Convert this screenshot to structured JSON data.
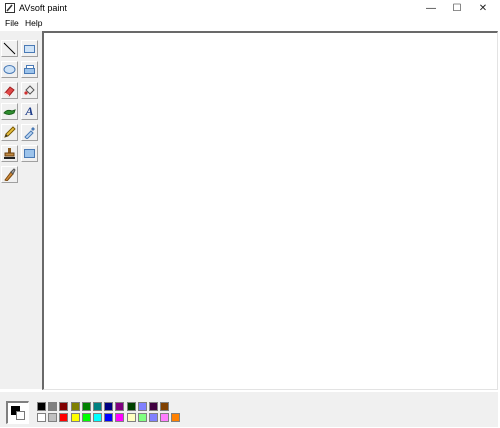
{
  "window": {
    "title": "AVsoft paint",
    "minimize_glyph": "—",
    "maximize_glyph": "☐",
    "close_glyph": "✕"
  },
  "menu": [
    {
      "label": "File"
    },
    {
      "label": "Help"
    }
  ],
  "tools": [
    {
      "name": "line-tool",
      "icon": "line-icon"
    },
    {
      "name": "rectangle-tool",
      "icon": "rectangle-icon"
    },
    {
      "name": "ellipse-tool",
      "icon": "ellipse-icon"
    },
    {
      "name": "filled-rectangle-tool",
      "icon": "filled-rectangle-icon"
    },
    {
      "name": "eraser-tool",
      "icon": "eraser-icon"
    },
    {
      "name": "fill-bucket-tool",
      "icon": "fill-bucket-icon"
    },
    {
      "name": "brush-tool",
      "icon": "brush-icon"
    },
    {
      "name": "text-tool",
      "icon": "text-icon",
      "glyph": "A"
    },
    {
      "name": "pencil-tool",
      "icon": "pencil-icon"
    },
    {
      "name": "color-picker-tool",
      "icon": "eyedropper-icon"
    },
    {
      "name": "stamp-tool",
      "icon": "stamp-icon"
    },
    {
      "name": "select-tool",
      "icon": "select-icon"
    },
    {
      "name": "spray-brush-tool",
      "icon": "spray-brush-icon"
    }
  ],
  "palette": {
    "foreground": "#000000",
    "background": "#ffffff",
    "row1": [
      "#000000",
      "#808080",
      "#800000",
      "#808000",
      "#008000",
      "#008080",
      "#000080",
      "#800080",
      "#004000",
      "#8080ff",
      "#400040",
      "#804000"
    ],
    "row2": [
      "#ffffff",
      "#c0c0c0",
      "#ff0000",
      "#ffff00",
      "#00ff00",
      "#00ffff",
      "#0000ff",
      "#ff00ff",
      "#ffffc0",
      "#80ff80",
      "#8080ff",
      "#ff80ff",
      "#ff8000"
    ]
  }
}
